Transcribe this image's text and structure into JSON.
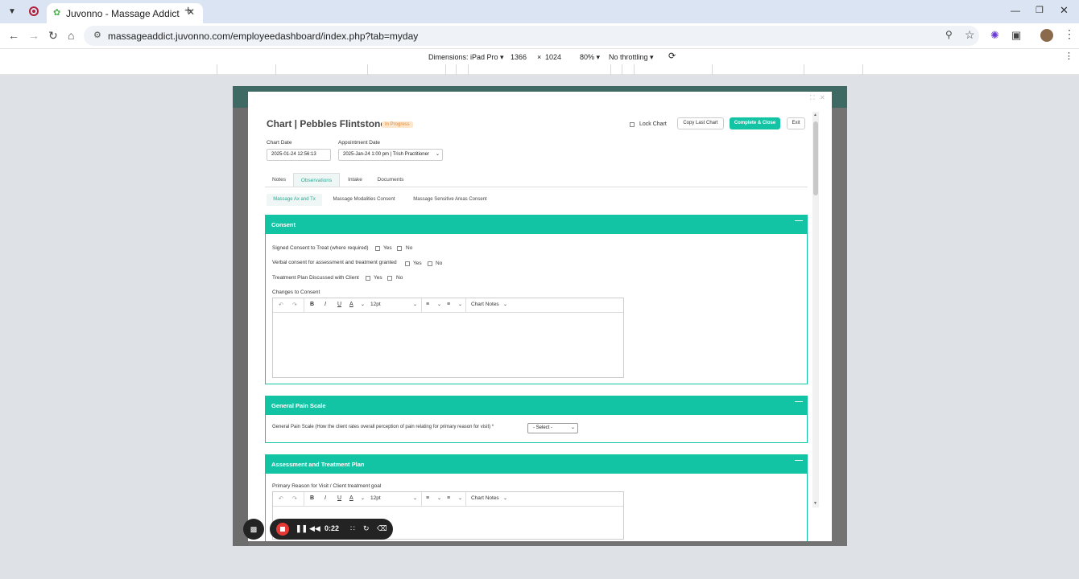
{
  "browser": {
    "tab_title": "Juvonno - Massage Addict",
    "url": "massageaddict.juvonno.com/employeedashboard/index.php?tab=myday"
  },
  "devtools": {
    "dimensions_label": "Dimensions: iPad Pro",
    "width": "1366",
    "x": "×",
    "height": "1024",
    "zoom": "80%",
    "throttling": "No throttling"
  },
  "chart": {
    "title": "Chart | Pebbles Flintstone",
    "status": "In Progress",
    "lock_label": "Lock Chart",
    "copy_label": "Copy Last Chart",
    "complete_label": "Complete & Close",
    "exit_label": "Exit",
    "chart_date_label": "Chart Date",
    "chart_date_value": "2025-01-24 12:56:13",
    "appt_date_label": "Appointment Date",
    "appt_date_value": "2025-Jan-24 1:00 pm | Trish Practitioner"
  },
  "tabs": [
    "Notes",
    "Observations",
    "Intake",
    "Documents"
  ],
  "subtabs": [
    "Massage Ax and Tx",
    "Massage Modalities Consent",
    "Massage Sensitive Areas Consent"
  ],
  "consent": {
    "header": "Consent",
    "q1": "Signed Consent to Treat (where required)",
    "q2": "Verbal consent for assessment and treatment granted",
    "q3": "Treatment Plan Discussed with Client",
    "yes": "Yes",
    "no": "No",
    "changes_label": "Changes to Consent"
  },
  "editor": {
    "font_size": "12pt",
    "chart_notes": "Chart Notes"
  },
  "pain": {
    "header": "General Pain Scale",
    "question": "General Pain Scale (How the client rates overall perception of pain relating for primary reason for visit) *",
    "select": "- Select -"
  },
  "assessment": {
    "header": "Assessment and Treatment Plan",
    "primary_label": "Primary Reason for Visit / Client treatment goal"
  },
  "recorder": {
    "time": "0:22"
  }
}
